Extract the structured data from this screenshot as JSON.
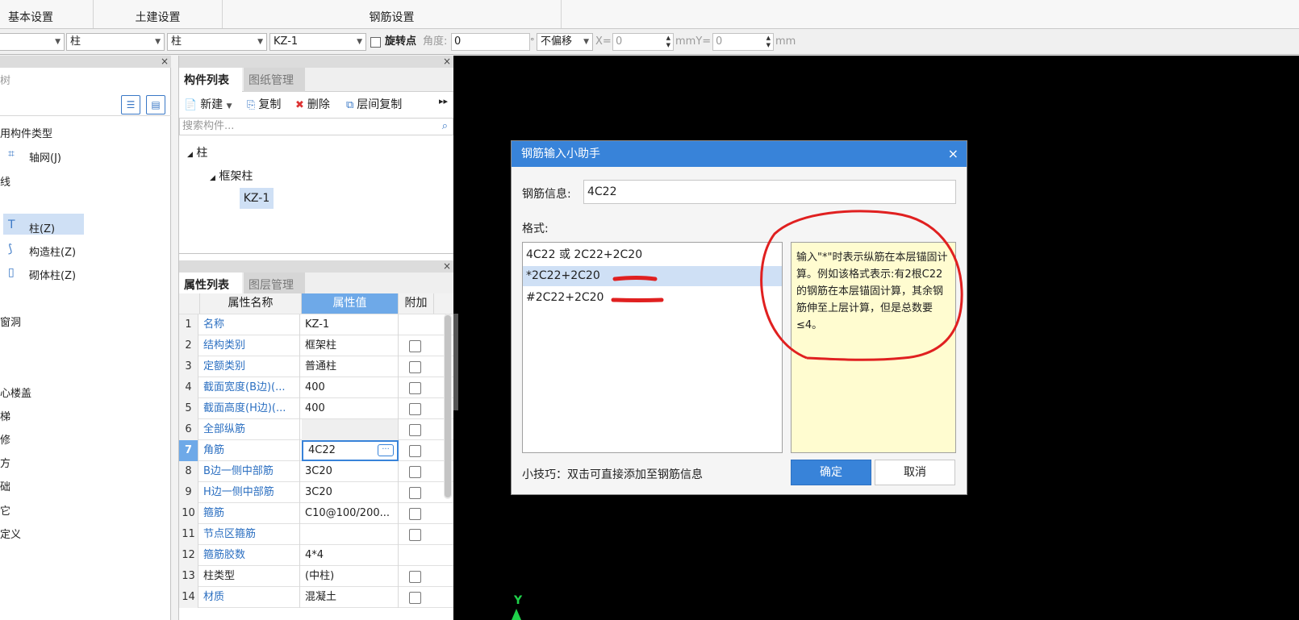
{
  "ribbon": {
    "tabs": [
      "基本设置",
      "土建设置",
      "钢筋设置"
    ]
  },
  "toolbar": {
    "combo1": "",
    "combo2": "柱",
    "combo3": "柱",
    "combo4": "KZ-1",
    "rotate_label": "旋转点",
    "angle_label": "角度:",
    "angle_value": "0",
    "angle_unit": "°",
    "offset_value": "不偏移",
    "x_label": "X=",
    "x_value": "0",
    "mm_y_label": "mmY=",
    "y_value": "0",
    "mm_label": "mm"
  },
  "left_panel": {
    "title_fragment": "树",
    "items": [
      {
        "label": "用构件类型"
      },
      {
        "label": "轴网(J)"
      },
      {
        "label": "线"
      },
      {
        "label": "柱(Z)"
      },
      {
        "label": "构造柱(Z)"
      },
      {
        "label": "砌体柱(Z)"
      },
      {
        "label": "窗洞"
      },
      {
        "label": "心楼盖"
      },
      {
        "label": "梯"
      },
      {
        "label": "修"
      },
      {
        "label": "方"
      },
      {
        "label": "础"
      },
      {
        "label": "它"
      },
      {
        "label": "定义"
      }
    ]
  },
  "component_panel": {
    "tabs": [
      "构件列表",
      "图纸管理"
    ],
    "tools": [
      "新建",
      "复制",
      "删除",
      "层间复制"
    ],
    "search_placeholder": "搜索构件...",
    "tree": [
      "柱",
      "框架柱",
      "KZ-1"
    ]
  },
  "property_panel": {
    "tabs": [
      "属性列表",
      "图层管理"
    ],
    "headers": [
      "属性名称",
      "属性值",
      "附加"
    ],
    "rows": [
      {
        "idx": "1",
        "name": "名称",
        "value": "KZ-1"
      },
      {
        "idx": "2",
        "name": "结构类别",
        "value": "框架柱"
      },
      {
        "idx": "3",
        "name": "定额类别",
        "value": "普通柱"
      },
      {
        "idx": "4",
        "name": "截面宽度(B边)(...",
        "value": "400"
      },
      {
        "idx": "5",
        "name": "截面高度(H边)(...",
        "value": "400"
      },
      {
        "idx": "6",
        "name": "全部纵筋",
        "value": ""
      },
      {
        "idx": "7",
        "name": "角筋",
        "value": "4C22"
      },
      {
        "idx": "8",
        "name": "B边一侧中部筋",
        "value": "3C20"
      },
      {
        "idx": "9",
        "name": "H边一侧中部筋",
        "value": "3C20"
      },
      {
        "idx": "10",
        "name": "箍筋",
        "value": "C10@100/200..."
      },
      {
        "idx": "11",
        "name": "节点区箍筋",
        "value": ""
      },
      {
        "idx": "12",
        "name": "箍筋胶数",
        "value": "4*4"
      },
      {
        "idx": "13",
        "name": "柱类型",
        "value": "(中柱)"
      },
      {
        "idx": "14",
        "name": "材质",
        "value": "混凝土"
      }
    ],
    "ellipsis": "···"
  },
  "dialog": {
    "title": "钢筋输入小助手",
    "info_label": "钢筋信息:",
    "info_value": "4C22",
    "format_label": "格式:",
    "formats": [
      "4C22 或 2C22+2C20",
      "*2C22+2C20",
      "#2C22+2C20"
    ],
    "tip": "输入\"*\"时表示纵筋在本层锚固计算。例如该格式表示:有2根C22的钢筋在本层锚固计算，其余钢筋伸至上层计算，但是总数要≤4。",
    "hint": "小技巧：双击可直接添加至钢筋信息",
    "ok": "确定",
    "cancel": "取消"
  },
  "canvas": {
    "axis_label": "Y"
  },
  "colors": {
    "accent": "#3883d9",
    "annotation": "#e02020",
    "link": "#2b6fc1"
  }
}
